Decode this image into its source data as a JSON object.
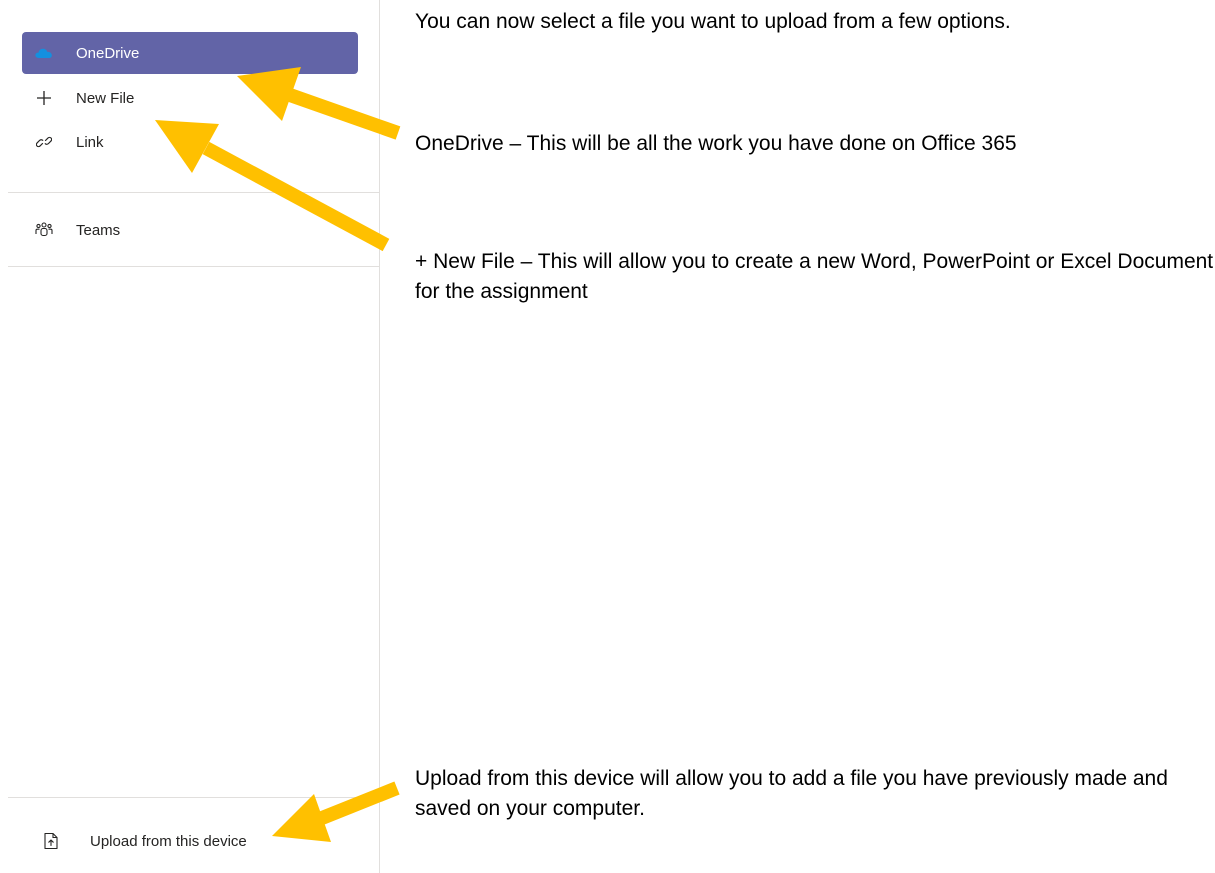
{
  "sidebar": {
    "items": [
      {
        "label": "OneDrive",
        "icon": "onedrive-cloud-icon",
        "active": true
      },
      {
        "label": "New File",
        "icon": "plus-icon",
        "active": false
      },
      {
        "label": "Link",
        "icon": "link-icon",
        "active": false
      },
      {
        "label": "Teams",
        "icon": "teams-icon",
        "active": false
      }
    ],
    "upload": {
      "label": "Upload from this device",
      "icon": "upload-icon"
    }
  },
  "annotations": {
    "intro": "You can now select a file you want to upload from a few options.",
    "onedrive": "OneDrive – This will be all the work you have done on Office 365",
    "new_file": "+ New File – This will allow you to create a new Word, PowerPoint or Excel Document for the assignment",
    "upload": "Upload from this device will allow you to add a file you have previously made and saved on your computer."
  },
  "colors": {
    "accent": "#6264a7",
    "arrow": "#ffc000",
    "onedrive_cloud": "#0f78d4",
    "divider": "#e1dfdd"
  }
}
